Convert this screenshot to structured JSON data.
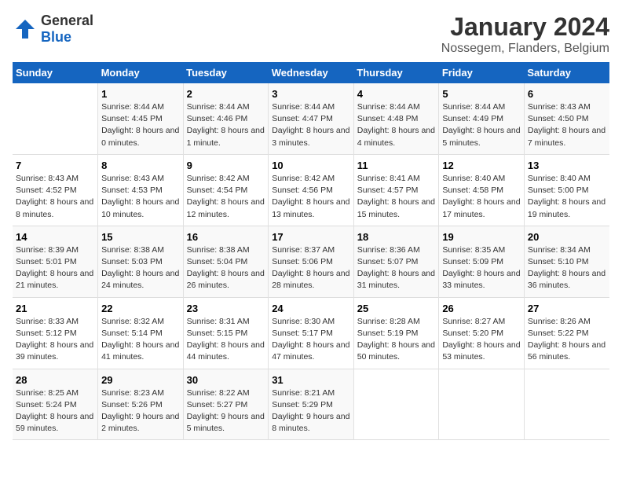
{
  "logo": {
    "general": "General",
    "blue": "Blue"
  },
  "title": "January 2024",
  "subtitle": "Nossegem, Flanders, Belgium",
  "weekdays": [
    "Sunday",
    "Monday",
    "Tuesday",
    "Wednesday",
    "Thursday",
    "Friday",
    "Saturday"
  ],
  "weeks": [
    [
      {
        "day": "",
        "sunrise": "",
        "sunset": "",
        "daylight": ""
      },
      {
        "day": "1",
        "sunrise": "Sunrise: 8:44 AM",
        "sunset": "Sunset: 4:45 PM",
        "daylight": "Daylight: 8 hours and 0 minutes."
      },
      {
        "day": "2",
        "sunrise": "Sunrise: 8:44 AM",
        "sunset": "Sunset: 4:46 PM",
        "daylight": "Daylight: 8 hours and 1 minute."
      },
      {
        "day": "3",
        "sunrise": "Sunrise: 8:44 AM",
        "sunset": "Sunset: 4:47 PM",
        "daylight": "Daylight: 8 hours and 3 minutes."
      },
      {
        "day": "4",
        "sunrise": "Sunrise: 8:44 AM",
        "sunset": "Sunset: 4:48 PM",
        "daylight": "Daylight: 8 hours and 4 minutes."
      },
      {
        "day": "5",
        "sunrise": "Sunrise: 8:44 AM",
        "sunset": "Sunset: 4:49 PM",
        "daylight": "Daylight: 8 hours and 5 minutes."
      },
      {
        "day": "6",
        "sunrise": "Sunrise: 8:43 AM",
        "sunset": "Sunset: 4:50 PM",
        "daylight": "Daylight: 8 hours and 7 minutes."
      }
    ],
    [
      {
        "day": "7",
        "sunrise": "Sunrise: 8:43 AM",
        "sunset": "Sunset: 4:52 PM",
        "daylight": "Daylight: 8 hours and 8 minutes."
      },
      {
        "day": "8",
        "sunrise": "Sunrise: 8:43 AM",
        "sunset": "Sunset: 4:53 PM",
        "daylight": "Daylight: 8 hours and 10 minutes."
      },
      {
        "day": "9",
        "sunrise": "Sunrise: 8:42 AM",
        "sunset": "Sunset: 4:54 PM",
        "daylight": "Daylight: 8 hours and 12 minutes."
      },
      {
        "day": "10",
        "sunrise": "Sunrise: 8:42 AM",
        "sunset": "Sunset: 4:56 PM",
        "daylight": "Daylight: 8 hours and 13 minutes."
      },
      {
        "day": "11",
        "sunrise": "Sunrise: 8:41 AM",
        "sunset": "Sunset: 4:57 PM",
        "daylight": "Daylight: 8 hours and 15 minutes."
      },
      {
        "day": "12",
        "sunrise": "Sunrise: 8:40 AM",
        "sunset": "Sunset: 4:58 PM",
        "daylight": "Daylight: 8 hours and 17 minutes."
      },
      {
        "day": "13",
        "sunrise": "Sunrise: 8:40 AM",
        "sunset": "Sunset: 5:00 PM",
        "daylight": "Daylight: 8 hours and 19 minutes."
      }
    ],
    [
      {
        "day": "14",
        "sunrise": "Sunrise: 8:39 AM",
        "sunset": "Sunset: 5:01 PM",
        "daylight": "Daylight: 8 hours and 21 minutes."
      },
      {
        "day": "15",
        "sunrise": "Sunrise: 8:38 AM",
        "sunset": "Sunset: 5:03 PM",
        "daylight": "Daylight: 8 hours and 24 minutes."
      },
      {
        "day": "16",
        "sunrise": "Sunrise: 8:38 AM",
        "sunset": "Sunset: 5:04 PM",
        "daylight": "Daylight: 8 hours and 26 minutes."
      },
      {
        "day": "17",
        "sunrise": "Sunrise: 8:37 AM",
        "sunset": "Sunset: 5:06 PM",
        "daylight": "Daylight: 8 hours and 28 minutes."
      },
      {
        "day": "18",
        "sunrise": "Sunrise: 8:36 AM",
        "sunset": "Sunset: 5:07 PM",
        "daylight": "Daylight: 8 hours and 31 minutes."
      },
      {
        "day": "19",
        "sunrise": "Sunrise: 8:35 AM",
        "sunset": "Sunset: 5:09 PM",
        "daylight": "Daylight: 8 hours and 33 minutes."
      },
      {
        "day": "20",
        "sunrise": "Sunrise: 8:34 AM",
        "sunset": "Sunset: 5:10 PM",
        "daylight": "Daylight: 8 hours and 36 minutes."
      }
    ],
    [
      {
        "day": "21",
        "sunrise": "Sunrise: 8:33 AM",
        "sunset": "Sunset: 5:12 PM",
        "daylight": "Daylight: 8 hours and 39 minutes."
      },
      {
        "day": "22",
        "sunrise": "Sunrise: 8:32 AM",
        "sunset": "Sunset: 5:14 PM",
        "daylight": "Daylight: 8 hours and 41 minutes."
      },
      {
        "day": "23",
        "sunrise": "Sunrise: 8:31 AM",
        "sunset": "Sunset: 5:15 PM",
        "daylight": "Daylight: 8 hours and 44 minutes."
      },
      {
        "day": "24",
        "sunrise": "Sunrise: 8:30 AM",
        "sunset": "Sunset: 5:17 PM",
        "daylight": "Daylight: 8 hours and 47 minutes."
      },
      {
        "day": "25",
        "sunrise": "Sunrise: 8:28 AM",
        "sunset": "Sunset: 5:19 PM",
        "daylight": "Daylight: 8 hours and 50 minutes."
      },
      {
        "day": "26",
        "sunrise": "Sunrise: 8:27 AM",
        "sunset": "Sunset: 5:20 PM",
        "daylight": "Daylight: 8 hours and 53 minutes."
      },
      {
        "day": "27",
        "sunrise": "Sunrise: 8:26 AM",
        "sunset": "Sunset: 5:22 PM",
        "daylight": "Daylight: 8 hours and 56 minutes."
      }
    ],
    [
      {
        "day": "28",
        "sunrise": "Sunrise: 8:25 AM",
        "sunset": "Sunset: 5:24 PM",
        "daylight": "Daylight: 8 hours and 59 minutes."
      },
      {
        "day": "29",
        "sunrise": "Sunrise: 8:23 AM",
        "sunset": "Sunset: 5:26 PM",
        "daylight": "Daylight: 9 hours and 2 minutes."
      },
      {
        "day": "30",
        "sunrise": "Sunrise: 8:22 AM",
        "sunset": "Sunset: 5:27 PM",
        "daylight": "Daylight: 9 hours and 5 minutes."
      },
      {
        "day": "31",
        "sunrise": "Sunrise: 8:21 AM",
        "sunset": "Sunset: 5:29 PM",
        "daylight": "Daylight: 9 hours and 8 minutes."
      },
      {
        "day": "",
        "sunrise": "",
        "sunset": "",
        "daylight": ""
      },
      {
        "day": "",
        "sunrise": "",
        "sunset": "",
        "daylight": ""
      },
      {
        "day": "",
        "sunrise": "",
        "sunset": "",
        "daylight": ""
      }
    ]
  ]
}
